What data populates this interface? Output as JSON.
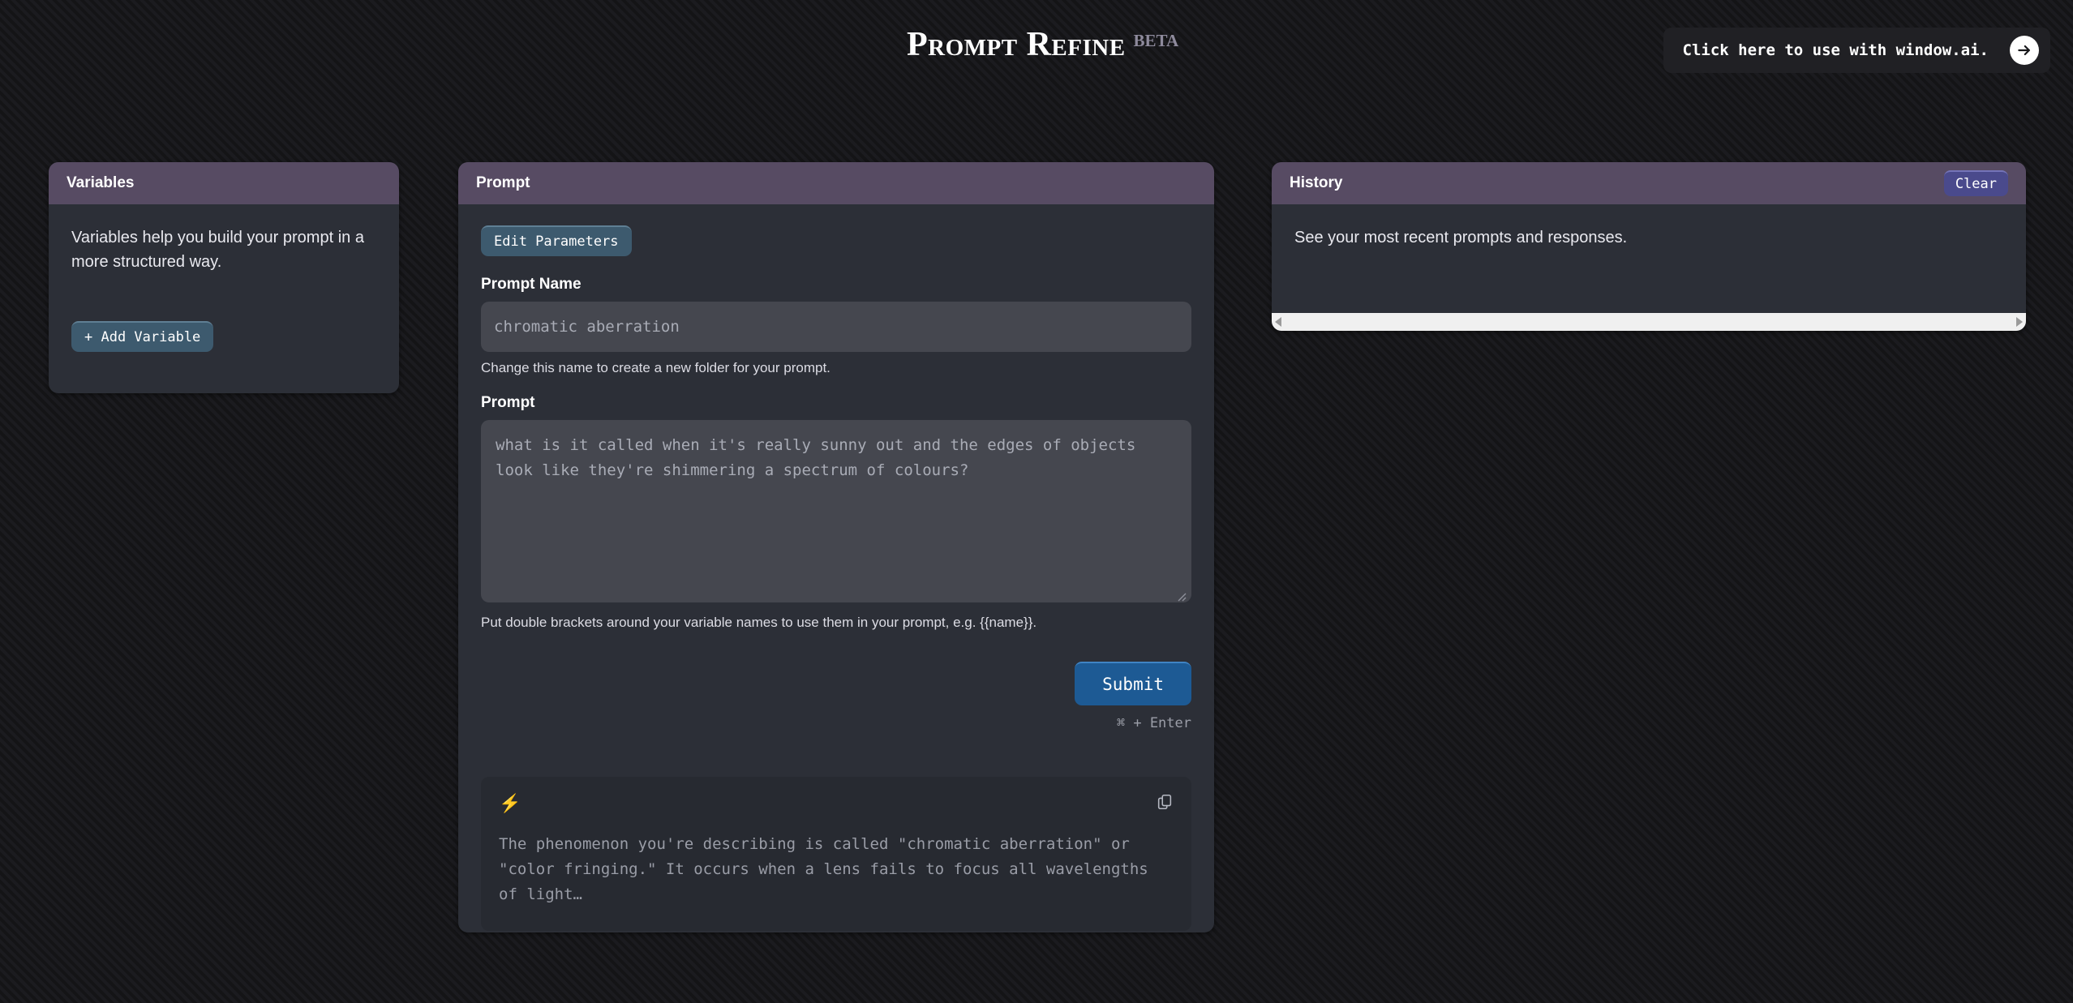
{
  "header": {
    "brand_title": "Prompt Refine",
    "brand_beta": "BETA",
    "windowai_button_label": "Click here to use with window.ai.",
    "arrow_icon": "arrow-right-icon"
  },
  "variables": {
    "card_title": "Variables",
    "description": "Variables help you build your prompt in a more structured way.",
    "add_button_label": "+ Add Variable"
  },
  "prompt": {
    "card_title": "Prompt",
    "edit_parameters_label": "Edit Parameters",
    "name_label": "Prompt Name",
    "name_value": "chromatic aberration",
    "name_placeholder": "chromatic aberration",
    "name_helper": "Change this name to create a new folder for your prompt.",
    "prompt_label": "Prompt",
    "prompt_value": "what is it called when it's really sunny out and the edges of objects look like they're shimmering a spectrum of colours?",
    "prompt_placeholder": "what is it called when it's really sunny out and the edges of objects look like they're shimmering a spectrum of colours?",
    "prompt_helper": "Put double brackets around your variable names to use them in your prompt, e.g. {{name}}.",
    "submit_label": "Submit",
    "shortcut_hint": "⌘ + Enter",
    "response": {
      "bolt_icon": "lightning-bolt-icon",
      "copy_icon": "copy-icon",
      "text": "The phenomenon you're describing is called \"chromatic aberration\" or \"color fringing.\" It occurs when a lens fails to focus all wavelengths of light…"
    }
  },
  "history": {
    "card_title": "History",
    "clear_label": "Clear",
    "empty_text": "See your most recent prompts and responses.",
    "scroll_left_icon": "scroll-left-arrow-icon",
    "scroll_right_icon": "scroll-right-arrow-icon"
  },
  "colors": {
    "background": "#141416",
    "card_body": "#2c2f37",
    "card_header_purple": "#574b63",
    "accent_blue": "#1d5a94",
    "pill_teal": "#3d5a6e",
    "clear_indigo": "#4a4a8c",
    "bolt_yellow": "#f3d467",
    "muted_text": "#9a9da7"
  }
}
